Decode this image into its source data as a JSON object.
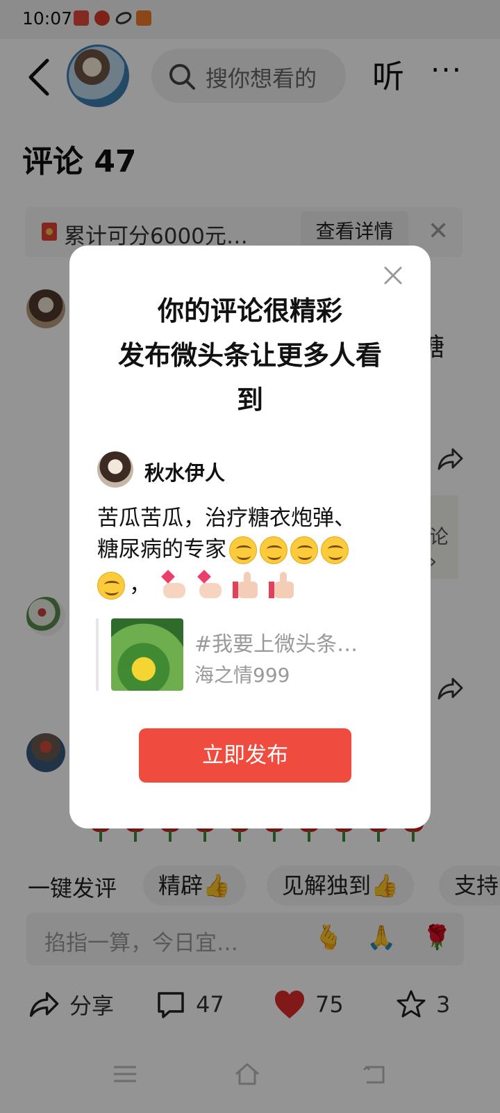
{
  "status_bar": {
    "time": "10:07",
    "icons": [
      "app-notification-icon",
      "app-notification-icon",
      "app-notification-icon",
      "app-notification-icon"
    ]
  },
  "header": {
    "search_placeholder": "搜你想看的",
    "listen_label": "听",
    "more_label": "···"
  },
  "comments": {
    "title": "评论 47",
    "reward_text": "累计可分6000元…",
    "reward_button": "查看详情",
    "visible_fragment": "糖",
    "more_fragment": "论 ›"
  },
  "quick_reply": {
    "label": "一键发评",
    "chips": [
      "精辟👍",
      "见解独到👍",
      "支持"
    ]
  },
  "comment_input": {
    "placeholder": "掐指一算，今日宜…",
    "emoji": [
      "🫰",
      "🙏",
      "🌹"
    ]
  },
  "actions": {
    "share_label": "分享",
    "comment_count": "47",
    "like_count": "75",
    "favorite_count": "3"
  },
  "modal": {
    "heading_line1": "你的评论很精彩",
    "heading_line2": "发布微头条让更多人看",
    "heading_line3": "到",
    "author": "秋水伊人",
    "text_line1": "苦瓜苦瓜，治疗糖衣炮弹、",
    "text_line2": "糖尿病的专家",
    "comma": "，",
    "quote_title": "#我要上微头条…",
    "quote_author": "海之情999",
    "publish_button": "立即发布"
  },
  "colors": {
    "accent": "#f04b3f",
    "like": "#e12b2b",
    "overlay": "rgba(0,0,0,0.42)"
  }
}
